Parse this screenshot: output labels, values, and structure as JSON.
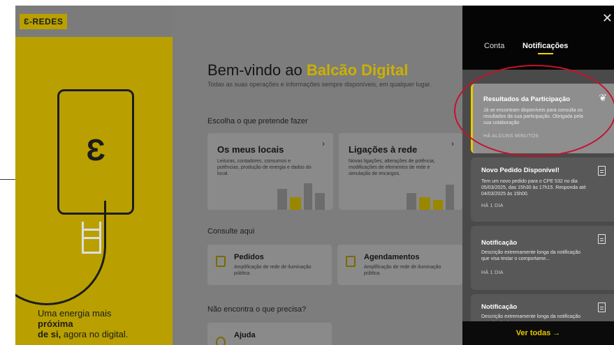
{
  "brand": {
    "logo": "Ɛ-REDES"
  },
  "hero": {
    "line1": "Uma energia mais",
    "line2": "próxima",
    "line3_bold": "de si,",
    "line3_rest": " agora no digital."
  },
  "main": {
    "welcome_prefix": "Bem-vindo ao ",
    "welcome_highlight": "Balcão Digital",
    "subtitle": "Todas as suas operações e informações sempre disponíveis, em qualquer lugar.",
    "choose_label": "Escolha o que pretende fazer",
    "cards": [
      {
        "title": "Os meus locais",
        "desc": "Leituras, contadores, consumos e potências, produção de energia e dados do local."
      },
      {
        "title": "Ligações à rede",
        "desc": "Novas ligações, alterações de potência, modificações de elementos de rede e simulação de encargos."
      }
    ],
    "consult_label": "Consulte aqui",
    "consult_cards": [
      {
        "title": "Pedidos",
        "desc": "Amplificação de rede de iluminação pública."
      },
      {
        "title": "Agendamentos",
        "desc": "Amplificação de rede de iluminação pública."
      }
    ],
    "not_found_label": "Não encontra o que precisa?",
    "help_title": "Ajuda"
  },
  "panel": {
    "tabs": [
      "Conta",
      "Notificações"
    ],
    "active_tab": "Notificações",
    "notifications": [
      {
        "title": "Resultados da Participação",
        "desc": "Já se encontram disponíveis para consulta os resultados da sua participação. Obrigada pela sua colaboração",
        "time": "HÁ ALGUNS MINUTOS",
        "icon": "leaf-icon"
      },
      {
        "title": "Novo Pedido Disponível!",
        "desc": "Tem um novo pedido para o CPE 532 no dia 05/03/2025, das 15h30 às 17h15. Responda até 04/03/2025 às 15h00.",
        "time": "HÁ 1 DIA",
        "icon": "document-icon"
      },
      {
        "title": "Notificação",
        "desc": "Descrição extremamente longa da notificação que visa testar o comportame...",
        "time": "HÁ 1 DIA",
        "icon": "document-icon"
      },
      {
        "title": "Notificação",
        "desc": "Descrição extremamente longa da notificação que visa testar o",
        "time": "",
        "icon": "document-icon"
      }
    ],
    "see_all": "Ver todas →"
  },
  "colors": {
    "accent": "#e8ca00",
    "panel_bg": "#4a4a4a",
    "highlight_ring": "#c8102e"
  }
}
